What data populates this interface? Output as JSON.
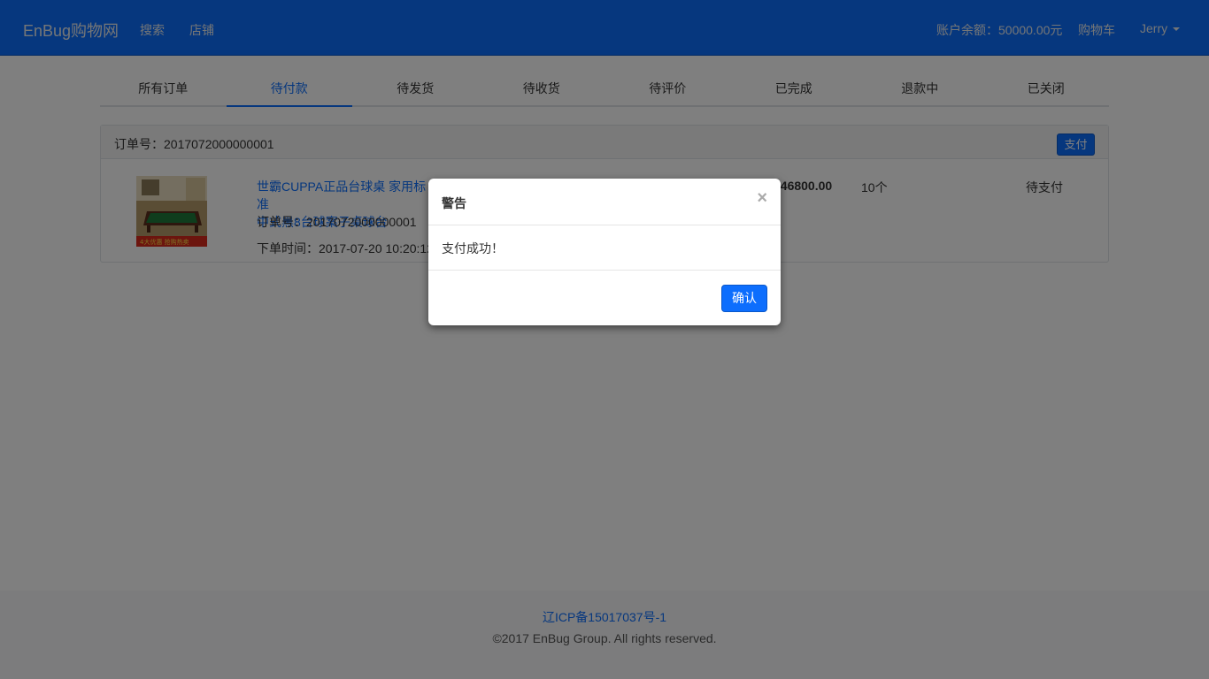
{
  "navbar": {
    "brand": "EnBug购物网",
    "links": [
      "搜索",
      "店铺"
    ],
    "balance": "账户余额：50000.00元",
    "cart": "购物车",
    "user": "Jerry"
  },
  "tabs": [
    "所有订单",
    "待付款",
    "待发货",
    "待收货",
    "待评价",
    "已完成",
    "退款中",
    "已关闭"
  ],
  "active_tab": "待付款",
  "order": {
    "header": "订单号：2017072000000001",
    "pay_label": "支付",
    "product_title_line1": "世霸CUPPA正品台球桌 家用标准",
    "product_title_line2": "中式黑8台球案子桌球台",
    "order_no": "订单号：2017072000000001",
    "order_time": "下单时间：2017-07-20 10:20:12.0",
    "price": "¥46800.00",
    "quantity": "10个",
    "status": "待支付",
    "thumb_banner": "4大优惠 抢购热卖"
  },
  "footer": {
    "icp": "辽ICP备15017037号-1",
    "copyright": "©2017 EnBug Group. All rights reserved."
  },
  "modal": {
    "title": "警告",
    "close": "×",
    "message": "支付成功！",
    "confirm": "确认"
  },
  "colors": {
    "primary": "#0d6efd",
    "backdrop": "rgba(0,0,0,0.5)"
  }
}
